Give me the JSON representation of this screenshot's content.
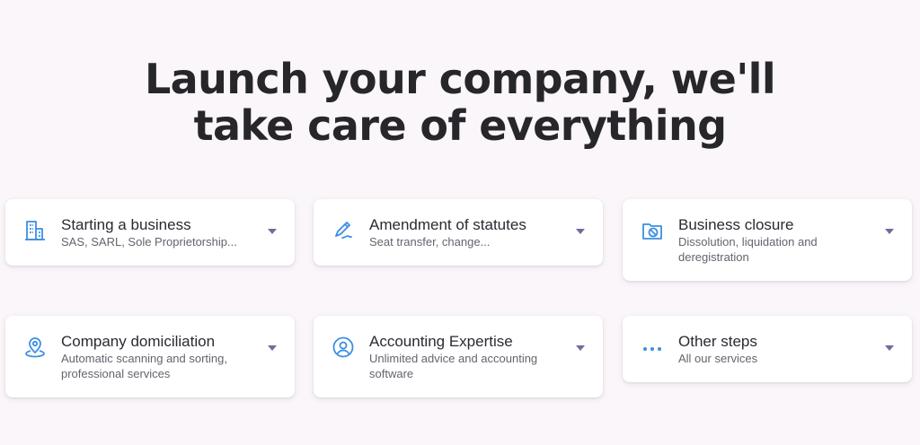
{
  "headline": {
    "line1": "Launch your company, we'll",
    "line2": "take care of everything"
  },
  "colors": {
    "icon": "#3b8fe3",
    "caret": "#6b6f9a",
    "background": "#fbf6fa"
  },
  "cards": [
    {
      "icon": "building-icon",
      "title": "Starting a business",
      "subtitle": "SAS, SARL, Sole Proprietorship..."
    },
    {
      "icon": "pen-icon",
      "title": "Amendment of statutes",
      "subtitle": "Seat transfer, change..."
    },
    {
      "icon": "closed-folder-icon",
      "title": "Business closure",
      "subtitle": "Dissolution, liquidation and deregistration"
    },
    {
      "icon": "location-pin-icon",
      "title": "Company domiciliation",
      "subtitle": "Automatic scanning and sorting, professional services"
    },
    {
      "icon": "user-circle-icon",
      "title": "Accounting Expertise",
      "subtitle": "Unlimited advice and accounting software"
    },
    {
      "icon": "more-dots-icon",
      "title": "Other steps",
      "subtitle": "All our services"
    }
  ]
}
